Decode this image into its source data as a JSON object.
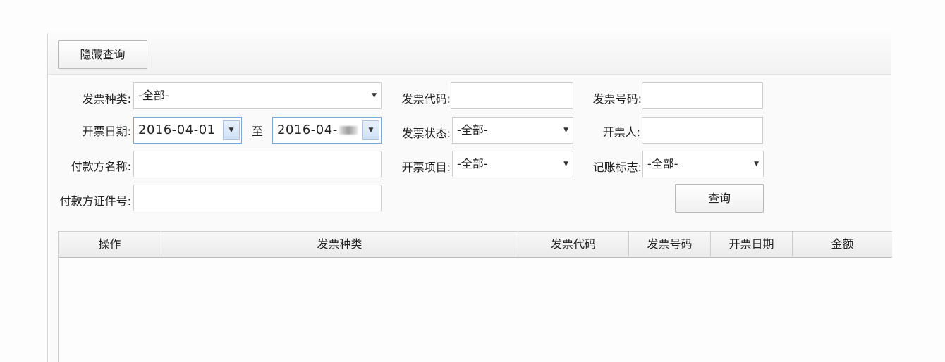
{
  "toolbar": {
    "hide_query_label": "隐藏查询"
  },
  "form": {
    "invoice_type_label": "发票种类:",
    "invoice_type_value": "-全部-",
    "invoice_code_label": "发票代码:",
    "invoice_code_value": "",
    "invoice_number_label": "发票号码:",
    "invoice_number_value": "",
    "issue_date_label": "开票日期:",
    "date_from_value": "2016-04-01",
    "date_to_label": "至",
    "date_to_value": "2016-04-",
    "invoice_status_label": "发票状态:",
    "invoice_status_value": "-全部-",
    "issuer_label": "开票人:",
    "issuer_value": "",
    "payer_name_label": "付款方名称:",
    "payer_name_value": "",
    "item_label": "开票项目:",
    "item_value": "-全部-",
    "bookkeeping_label": "记账标志:",
    "bookkeeping_value": "-全部-",
    "payer_id_label": "付款方证件号:",
    "payer_id_value": "",
    "query_button": "查询"
  },
  "table": {
    "columns": [
      "操作",
      "发票种类",
      "发票代码",
      "发票号码",
      "开票日期",
      "金额"
    ],
    "rows": []
  },
  "icons": {
    "dropdown": "caret-down-icon",
    "date_picker": "caret-down-icon"
  },
  "colors": {
    "date_border": "#7fa7d6",
    "date_button": "#cfe0f5"
  }
}
